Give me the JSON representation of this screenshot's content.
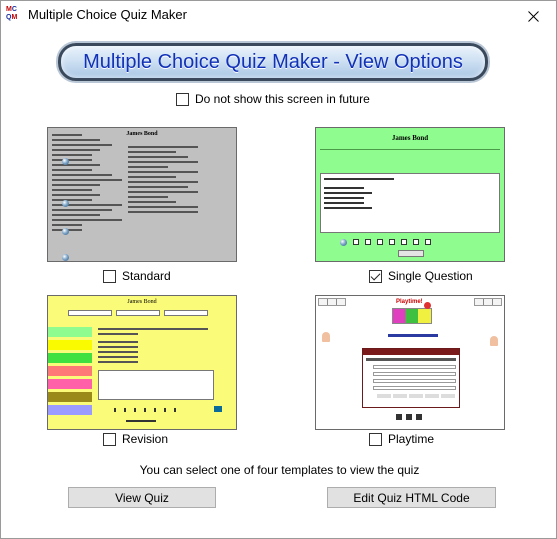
{
  "window": {
    "title": "Multiple Choice Quiz Maker",
    "icon_text": {
      "line1_a": "M",
      "line1_b": "C",
      "line2_a": "Q",
      "line2_b": "M"
    }
  },
  "banner": {
    "text": "Multiple Choice Quiz Maker - View Options"
  },
  "dont_show": {
    "label": "Do not show this screen in future",
    "checked": false
  },
  "templates": [
    {
      "id": "standard",
      "label": "Standard",
      "checked": false,
      "preview_title": "James Bond"
    },
    {
      "id": "single",
      "label": "Single Question",
      "checked": true,
      "preview_title": "James Bond"
    },
    {
      "id": "revision",
      "label": "Revision",
      "checked": false,
      "preview_title": "James Bond"
    },
    {
      "id": "playtime",
      "label": "Playtime",
      "checked": false,
      "preview_title": "Playtime!"
    }
  ],
  "footer": {
    "text": "You can select one of four templates to view the quiz"
  },
  "buttons": {
    "view_quiz": "View Quiz",
    "edit_html": "Edit Quiz HTML Code"
  },
  "colors": {
    "standard_bg": "#c0c0c0",
    "single_bg": "#8efc8e",
    "revision_bg": "#fbfb7a",
    "banner_text": "#1131b8"
  }
}
